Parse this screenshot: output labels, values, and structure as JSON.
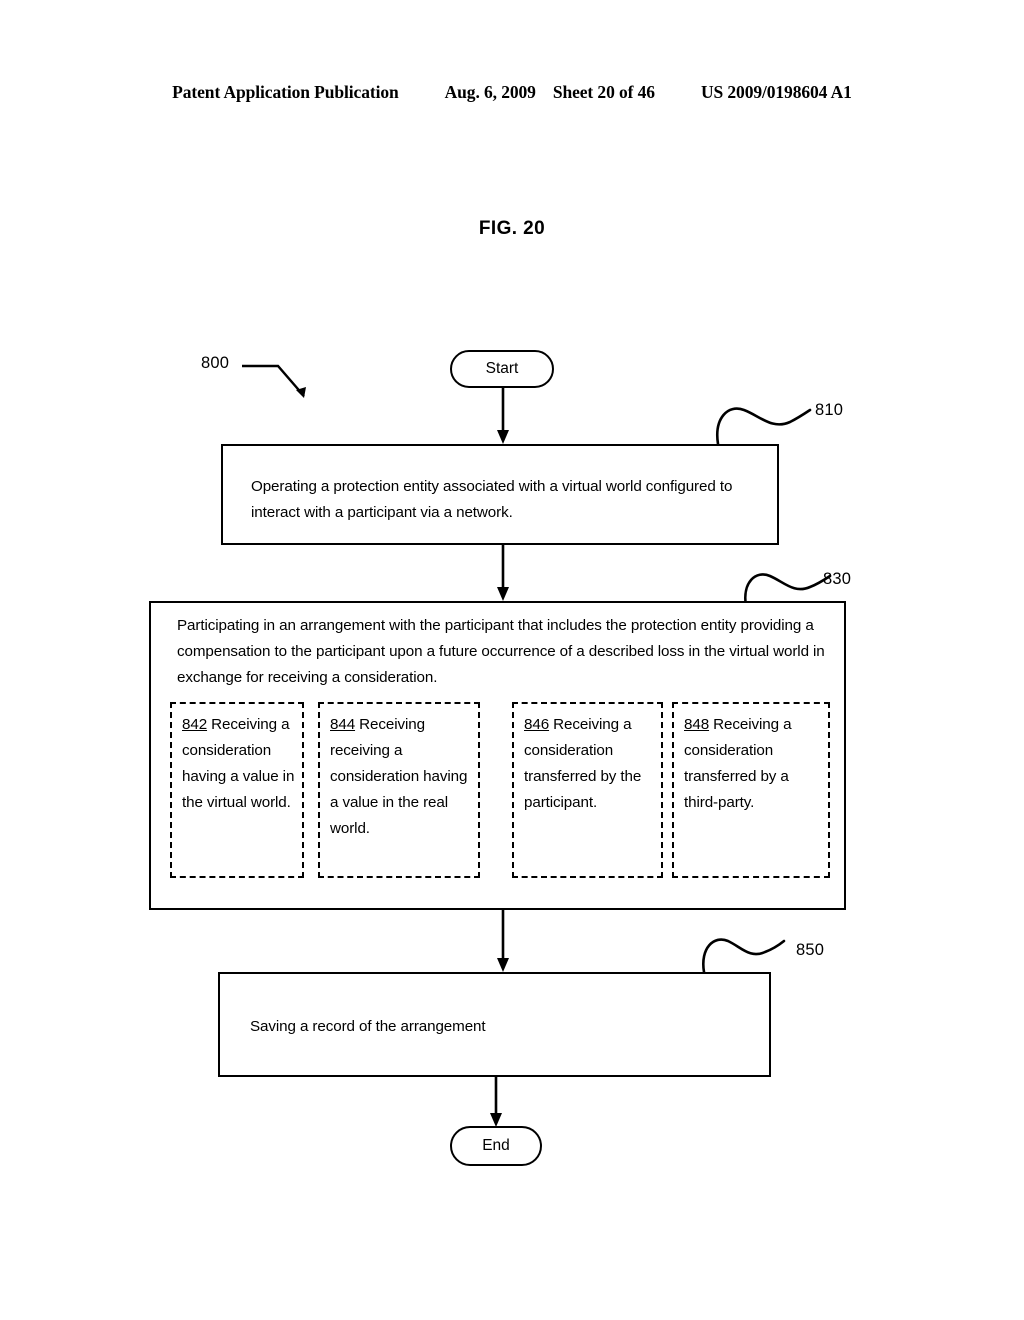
{
  "header": {
    "publication": "Patent Application Publication",
    "date": "Aug. 6, 2009",
    "sheet": "Sheet 20 of 46",
    "patent_number": "US 2009/0198604 A1"
  },
  "figure": {
    "title": "FIG. 20",
    "diagram_reference": "800"
  },
  "nodes": {
    "start": {
      "label": "Start"
    },
    "end": {
      "label": "End"
    },
    "step_810": {
      "ref": "810",
      "text": "Operating a protection entity associated with a virtual world configured to interact with a participant via a network."
    },
    "step_830": {
      "ref": "830",
      "text": "Participating in an arrangement with the participant that includes the protection entity providing a compensation to the participant upon a future occurrence of a described loss in the virtual world in exchange for receiving a consideration.",
      "substeps": [
        {
          "ref": "842",
          "text": "Receiving a consideration having a value in the virtual world."
        },
        {
          "ref": "844",
          "text": "Receiving receiving a consideration having a value in the real world."
        },
        {
          "ref": "846",
          "text": "Receiving a consideration transferred by the participant."
        },
        {
          "ref": "848",
          "text": "Receiving a consideration transferred by a third-party."
        }
      ]
    },
    "step_850": {
      "ref": "850",
      "text": "Saving a record of the arrangement"
    }
  },
  "colors": {
    "ink": "#000000",
    "paper": "#ffffff"
  }
}
